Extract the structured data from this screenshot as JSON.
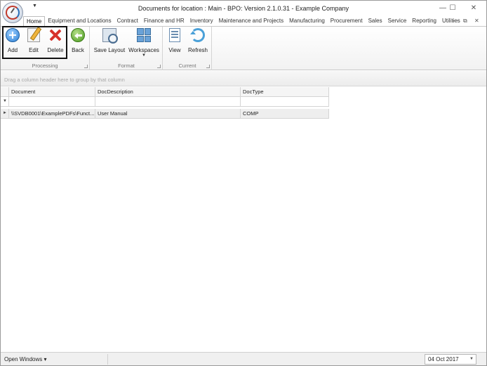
{
  "window": {
    "title": "Documents for location : Main - BPO: Version 2.1.0.31 - Example Company",
    "minimize": "—",
    "maximize": "☐",
    "close": "✕"
  },
  "qat": {
    "dropdown_arrow": "▼"
  },
  "ribbon": {
    "tabs": [
      "Home",
      "Equipment and Locations",
      "Contract",
      "Finance and HR",
      "Inventory",
      "Maintenance and Projects",
      "Manufacturing",
      "Procurement",
      "Sales",
      "Service",
      "Reporting",
      "Utilities"
    ],
    "help_glyph": "—",
    "restore_glyph": "⧉",
    "close_glyph": "✕",
    "groups": {
      "processing": {
        "label": "Processing",
        "buttons": {
          "add": "Add",
          "edit": "Edit",
          "delete": "Delete"
        }
      },
      "back": {
        "label": "Back"
      },
      "format": {
        "label": "Format",
        "buttons": {
          "save_layout": "Save Layout",
          "workspaces": "Workspaces"
        }
      },
      "current": {
        "label": "Current",
        "buttons": {
          "view": "View",
          "refresh": "Refresh"
        }
      }
    }
  },
  "group_panel": {
    "placeholder": "Drag a column header here to group by that column"
  },
  "grid": {
    "columns": [
      "Document",
      "DocDescription",
      "DocType"
    ],
    "filter_glyph": "▼",
    "rows": [
      {
        "indicator": "►",
        "document": "\\\\SVDB0001\\ExamplePDFs\\Funct...",
        "description": "User Manual",
        "type": "COMP"
      }
    ]
  },
  "statusbar": {
    "open_windows": "Open Windows ▾",
    "date": "04 Oct 2017",
    "date_dropdown": "▼"
  }
}
